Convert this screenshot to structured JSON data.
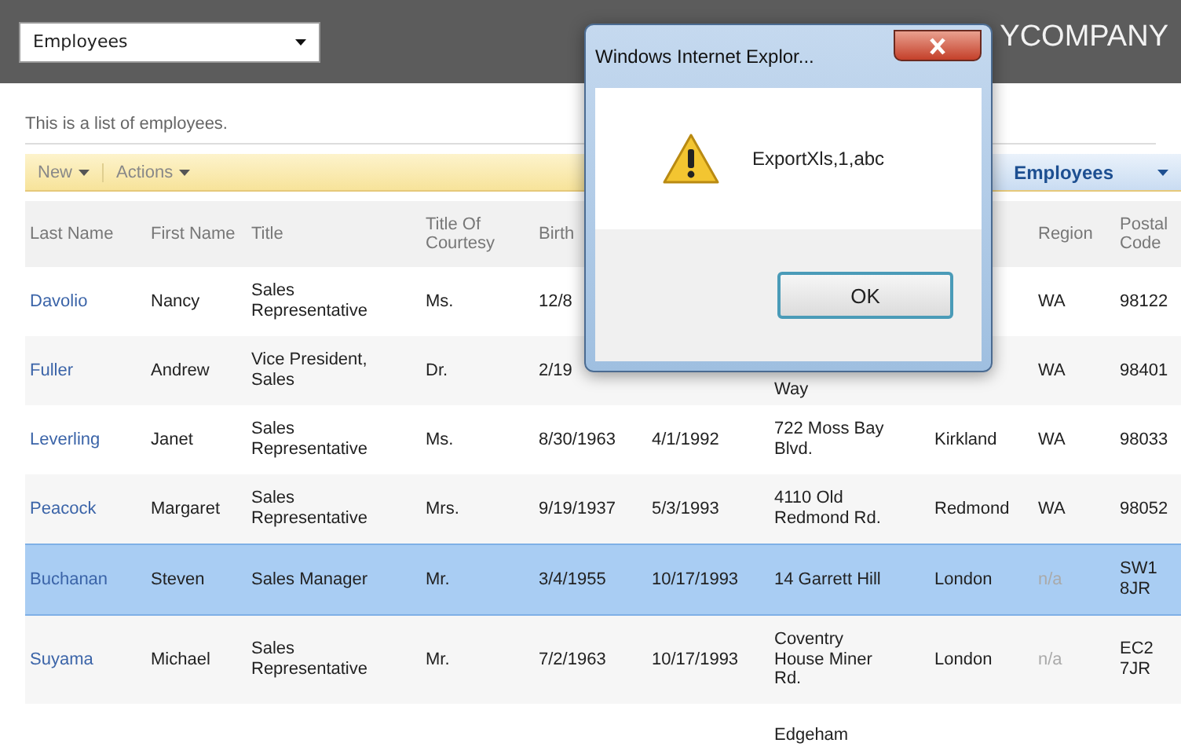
{
  "header": {
    "list_selector": {
      "value": "Employees"
    },
    "brand": "YCOMPANY"
  },
  "description": "This is a list of employees.",
  "toolbar": {
    "menus": [
      "New",
      "Actions"
    ],
    "view_selector": "Employees"
  },
  "table": {
    "columns": [
      "Last Name",
      "First Name",
      "Title",
      "Title Of Courtesy",
      "Birth",
      "",
      "",
      "",
      "Region",
      "Postal Code"
    ],
    "rows": [
      {
        "selected": false,
        "last_name": "Davolio",
        "first_name": "Nancy",
        "title": "Sales Representative",
        "courtesy": "Ms.",
        "birth_date": "12/8",
        "region": "WA",
        "postal_code": "98122"
      },
      {
        "selected": false,
        "last_name": "Fuller",
        "first_name": "Andrew",
        "title": "Vice President, Sales",
        "courtesy": "Dr.",
        "birth_date": "2/19",
        "address": "Way",
        "address_top_hidden": true,
        "region": "WA",
        "postal_code": "98401"
      },
      {
        "selected": false,
        "last_name": "Leverling",
        "first_name": "Janet",
        "title": "Sales Representative",
        "courtesy": "Ms.",
        "birth_date": "8/30/1963",
        "hire_date": "4/1/1992",
        "address": "722 Moss Bay Blvd.",
        "city": "Kirkland",
        "region": "WA",
        "postal_code": "98033"
      },
      {
        "selected": false,
        "last_name": "Peacock",
        "first_name": "Margaret",
        "title": "Sales Representative",
        "courtesy": "Mrs.",
        "birth_date": "9/19/1937",
        "hire_date": "5/3/1993",
        "address": "4110 Old Redmond Rd.",
        "city": "Redmond",
        "region": "WA",
        "postal_code": "98052"
      },
      {
        "selected": true,
        "last_name": "Buchanan",
        "first_name": "Steven",
        "title": "Sales Manager",
        "courtesy": "Mr.",
        "birth_date": "3/4/1955",
        "hire_date": "10/17/1993",
        "address": "14 Garrett Hill",
        "city": "London",
        "region": "n/a",
        "postal_code": "SW1 8JR"
      },
      {
        "selected": false,
        "last_name": "Suyama",
        "first_name": "Michael",
        "title": "Sales Representative",
        "courtesy": "Mr.",
        "birth_date": "7/2/1963",
        "hire_date": "10/17/1993",
        "address": "Coventry House Miner Rd.",
        "city": "London",
        "region": "n/a",
        "postal_code": "EC2 7JR"
      },
      {
        "selected": false,
        "address": "Edgeham"
      }
    ]
  },
  "dialog": {
    "title": "Windows Internet Explor...",
    "message": "ExportXls,1,abc",
    "buttons": [
      "OK"
    ]
  }
}
